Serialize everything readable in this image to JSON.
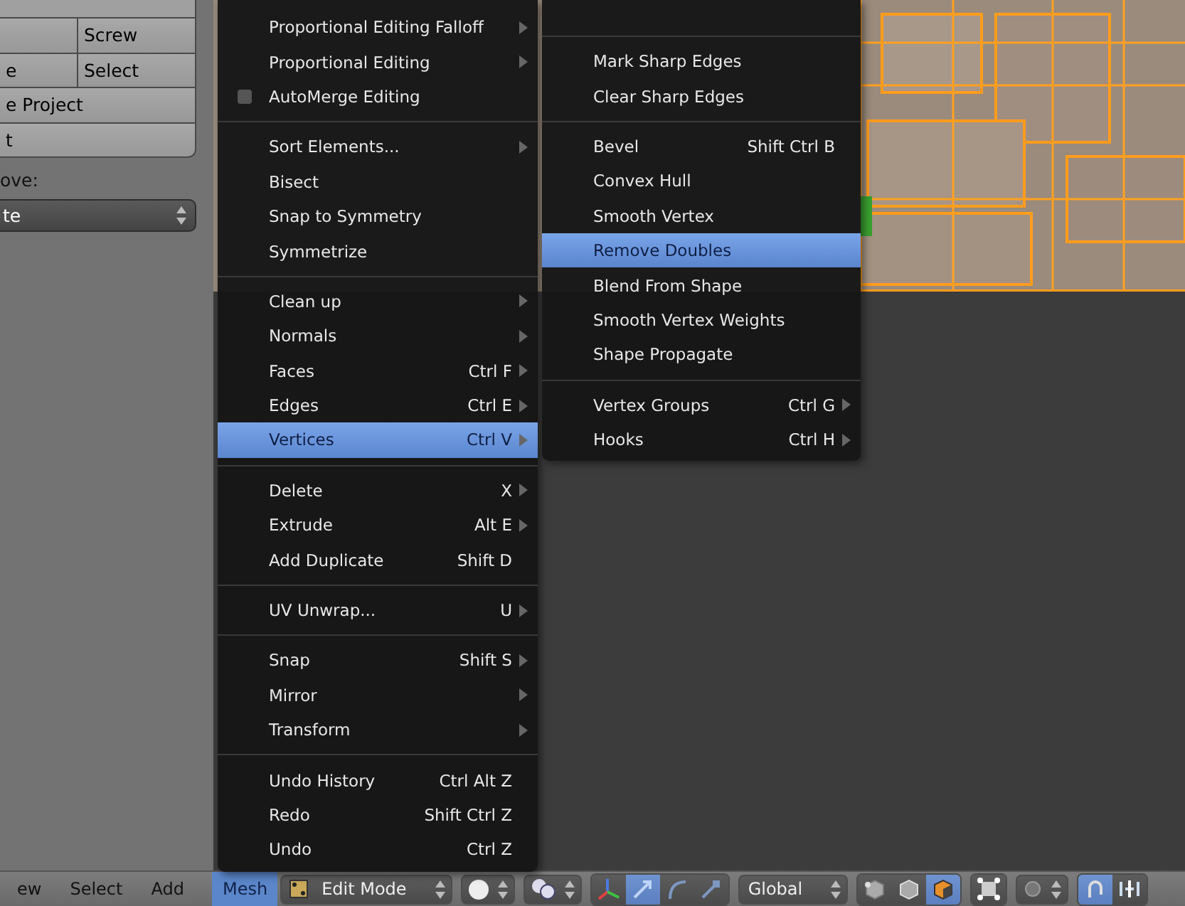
{
  "left_panel": {
    "rows": [
      {
        "kind": "stub",
        "cells": []
      },
      {
        "kind": "pair",
        "cells": [
          "",
          "Screw"
        ]
      },
      {
        "kind": "pair",
        "cells": [
          "e",
          "Select"
        ]
      },
      {
        "kind": "single",
        "cells": [
          "e Project"
        ]
      },
      {
        "kind": "single-last",
        "cells": [
          "t"
        ]
      }
    ],
    "label": "ove:",
    "dropdown": "te"
  },
  "mesh_menu": {
    "items": [
      {
        "kind": "item",
        "label": "Proportional Editing Falloff",
        "submenu": true,
        "selected": false
      },
      {
        "kind": "item",
        "label": "Proportional Editing",
        "submenu": true,
        "selected": false
      },
      {
        "kind": "check",
        "label": "AutoMerge Editing",
        "checked": false,
        "submenu": false,
        "selected": false
      },
      {
        "kind": "separator"
      },
      {
        "kind": "item",
        "label": "Sort Elements...",
        "submenu": true,
        "selected": false
      },
      {
        "kind": "item",
        "label": "Bisect",
        "submenu": false,
        "selected": false
      },
      {
        "kind": "item",
        "label": "Snap to Symmetry",
        "submenu": false,
        "selected": false
      },
      {
        "kind": "item",
        "label": "Symmetrize",
        "submenu": false,
        "selected": false
      },
      {
        "kind": "separator"
      },
      {
        "kind": "item",
        "label": "Clean up",
        "submenu": true,
        "selected": false
      },
      {
        "kind": "item",
        "label": "Normals",
        "submenu": true,
        "selected": false
      },
      {
        "kind": "item",
        "label": "Faces",
        "shortcut": "Ctrl F",
        "submenu": true,
        "selected": false
      },
      {
        "kind": "item",
        "label": "Edges",
        "shortcut": "Ctrl E",
        "submenu": true,
        "selected": false
      },
      {
        "kind": "item",
        "label": "Vertices",
        "shortcut": "Ctrl V",
        "submenu": true,
        "selected": true
      },
      {
        "kind": "separator"
      },
      {
        "kind": "item",
        "label": "Delete",
        "shortcut": "X",
        "submenu": true,
        "selected": false
      },
      {
        "kind": "item",
        "label": "Extrude",
        "shortcut": "Alt E",
        "submenu": true,
        "selected": false
      },
      {
        "kind": "item",
        "label": "Add Duplicate",
        "shortcut": "Shift D",
        "submenu": false,
        "selected": false
      },
      {
        "kind": "separator"
      },
      {
        "kind": "item",
        "label": "UV Unwrap...",
        "shortcut": "U",
        "submenu": true,
        "selected": false
      },
      {
        "kind": "separator"
      },
      {
        "kind": "item",
        "label": "Snap",
        "shortcut": "Shift S",
        "submenu": true,
        "selected": false
      },
      {
        "kind": "item",
        "label": "Mirror",
        "submenu": true,
        "selected": false
      },
      {
        "kind": "item",
        "label": "Transform",
        "submenu": true,
        "selected": false
      },
      {
        "kind": "separator"
      },
      {
        "kind": "item",
        "label": "Undo History",
        "shortcut": "Ctrl Alt Z",
        "submenu": false,
        "selected": false
      },
      {
        "kind": "item",
        "label": "Redo",
        "shortcut": "Shift Ctrl Z",
        "submenu": false,
        "selected": false
      },
      {
        "kind": "item",
        "label": "Undo",
        "shortcut": "Ctrl Z",
        "submenu": false,
        "selected": false
      }
    ]
  },
  "vertices_submenu": {
    "items": [
      {
        "kind": "separator"
      },
      {
        "kind": "item",
        "label": "Mark Sharp Edges",
        "submenu": false,
        "selected": false
      },
      {
        "kind": "item",
        "label": "Clear Sharp Edges",
        "submenu": false,
        "selected": false
      },
      {
        "kind": "separator"
      },
      {
        "kind": "item",
        "label": "Bevel",
        "shortcut": "Shift Ctrl B",
        "submenu": false,
        "selected": false
      },
      {
        "kind": "item",
        "label": "Convex Hull",
        "submenu": false,
        "selected": false
      },
      {
        "kind": "item",
        "label": "Smooth Vertex",
        "submenu": false,
        "selected": false
      },
      {
        "kind": "item",
        "label": "Remove Doubles",
        "submenu": false,
        "selected": true
      },
      {
        "kind": "item",
        "label": "Blend From Shape",
        "submenu": false,
        "selected": false
      },
      {
        "kind": "item",
        "label": "Smooth Vertex Weights",
        "submenu": false,
        "selected": false
      },
      {
        "kind": "item",
        "label": "Shape Propagate",
        "submenu": false,
        "selected": false
      },
      {
        "kind": "separator"
      },
      {
        "kind": "item",
        "label": "Vertex Groups",
        "shortcut": "Ctrl G",
        "submenu": true,
        "selected": false
      },
      {
        "kind": "item",
        "label": "Hooks",
        "shortcut": "Ctrl H",
        "submenu": true,
        "selected": false
      }
    ]
  },
  "header": {
    "items": [
      {
        "kind": "menu",
        "label": "ew",
        "selected": false
      },
      {
        "kind": "menu",
        "label": "Select",
        "selected": false
      },
      {
        "kind": "menu",
        "label": "Add",
        "selected": false
      },
      {
        "kind": "menu",
        "label": "Mesh",
        "selected": true
      },
      {
        "kind": "dropdown",
        "label": "Edit Mode"
      },
      {
        "kind": "dropdown"
      },
      {
        "kind": "dropdown"
      },
      {
        "kind": "toggles",
        "items": [
          {
            "selected": false
          },
          {
            "selected": true
          },
          {
            "selected": false
          },
          {
            "selected": false
          }
        ]
      },
      {
        "kind": "dropdown",
        "label": "Global"
      },
      {
        "kind": "toggles",
        "items": [
          {
            "selected": false
          },
          {
            "selected": false
          },
          {
            "selected": true
          }
        ]
      },
      {
        "kind": "toggles",
        "items": [
          {
            "selected": false
          }
        ]
      },
      {
        "kind": "dropdown"
      },
      {
        "kind": "toggles",
        "items": [
          {
            "selected": true
          },
          {
            "selected": false
          }
        ]
      }
    ]
  }
}
